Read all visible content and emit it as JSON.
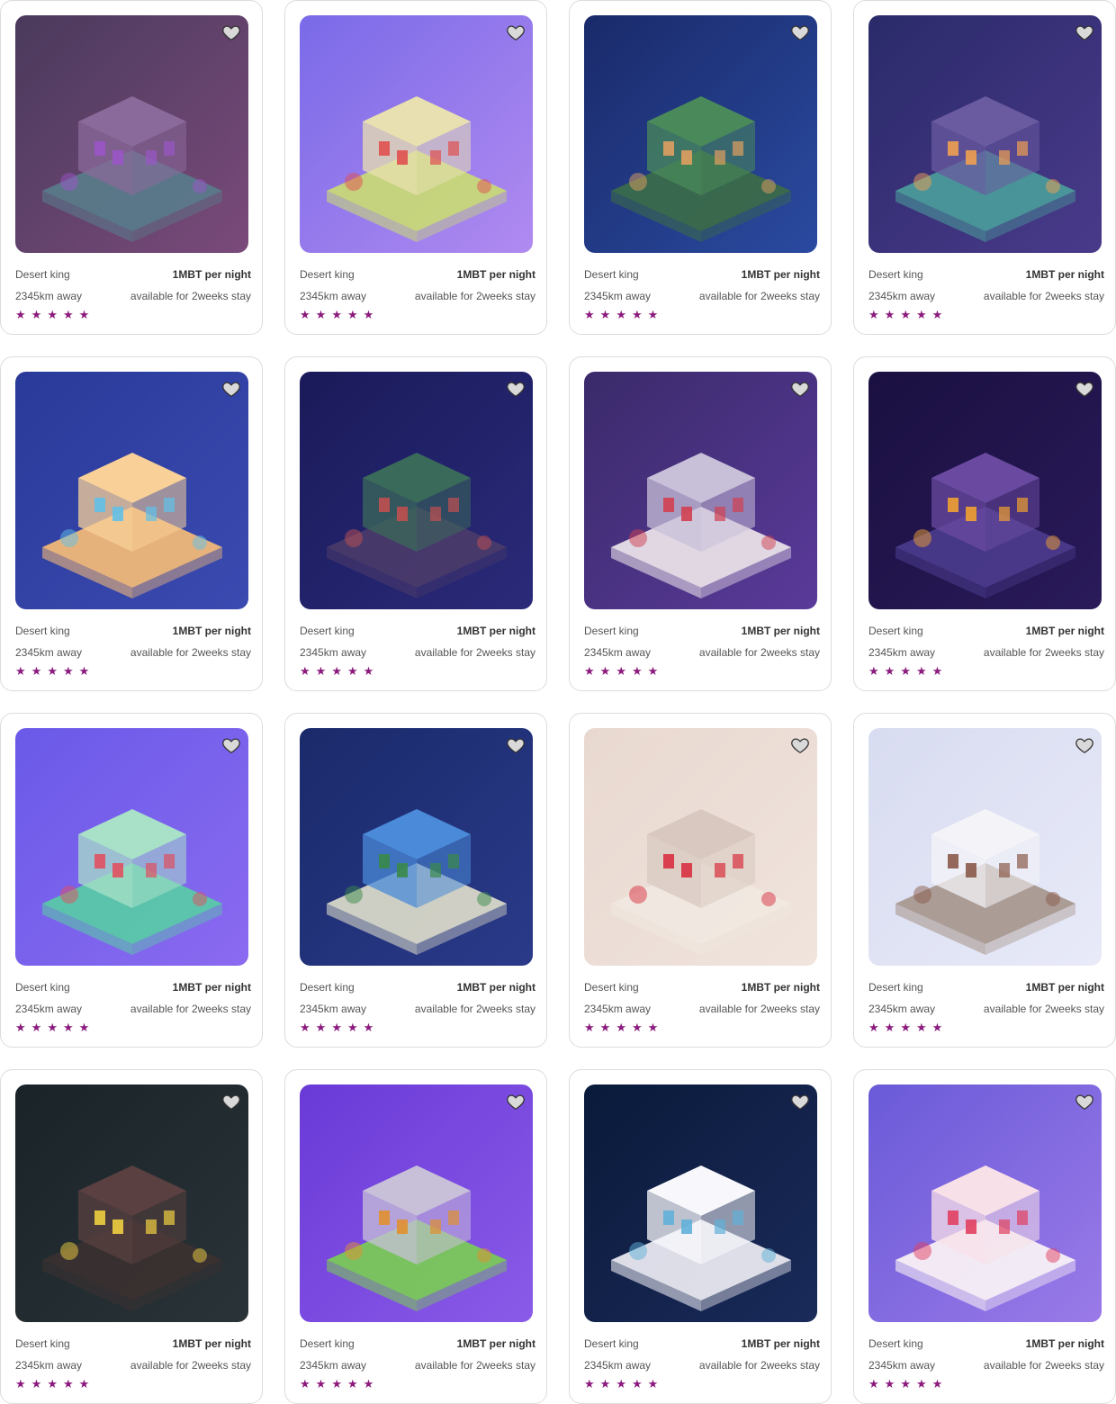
{
  "listings": [
    {
      "name": "Desert king",
      "price": "1MBT per night",
      "distance": "2345km away",
      "availability": "available for 2weeks stay",
      "rating": 5,
      "theme": "violet-tower"
    },
    {
      "name": "Desert king",
      "price": "1MBT per night",
      "distance": "2345km away",
      "availability": "available for 2weeks stay",
      "rating": 5,
      "theme": "fantasy-city"
    },
    {
      "name": "Desert king",
      "price": "1MBT per night",
      "distance": "2345km away",
      "availability": "available for 2weeks stay",
      "rating": 5,
      "theme": "floating-island"
    },
    {
      "name": "Desert king",
      "price": "1MBT per night",
      "distance": "2345km away",
      "availability": "available for 2weeks stay",
      "rating": 5,
      "theme": "night-castle"
    },
    {
      "name": "Desert king",
      "price": "1MBT per night",
      "distance": "2345km away",
      "availability": "available for 2weeks stay",
      "rating": 5,
      "theme": "desert-house"
    },
    {
      "name": "Desert king",
      "price": "1MBT per night",
      "distance": "2345km away",
      "availability": "available for 2weeks stay",
      "rating": 5,
      "theme": "forest-tower"
    },
    {
      "name": "Desert king",
      "price": "1MBT per night",
      "distance": "2345km away",
      "availability": "available for 2weeks stay",
      "rating": 5,
      "theme": "space-lab"
    },
    {
      "name": "Desert king",
      "price": "1MBT per night",
      "distance": "2345km away",
      "availability": "available for 2weeks stay",
      "rating": 5,
      "theme": "neon-temple"
    },
    {
      "name": "Desert king",
      "price": "1MBT per night",
      "distance": "2345km away",
      "availability": "available for 2weeks stay",
      "rating": 5,
      "theme": "market-stall"
    },
    {
      "name": "Desert king",
      "price": "1MBT per night",
      "distance": "2345km away",
      "availability": "available for 2weeks stay",
      "rating": 5,
      "theme": "stone-fort"
    },
    {
      "name": "Desert king",
      "price": "1MBT per night",
      "distance": "2345km away",
      "availability": "available for 2weeks stay",
      "rating": 5,
      "theme": "toy-workshop"
    },
    {
      "name": "Desert king",
      "price": "1MBT per night",
      "distance": "2345km away",
      "availability": "available for 2weeks stay",
      "rating": 5,
      "theme": "snow-cottage"
    },
    {
      "name": "Desert king",
      "price": "1MBT per night",
      "distance": "2345km away",
      "availability": "available for 2weeks stay",
      "rating": 5,
      "theme": "neon-diner"
    },
    {
      "name": "Desert king",
      "price": "1MBT per night",
      "distance": "2345km away",
      "availability": "available for 2weeks stay",
      "rating": 5,
      "theme": "autumn-bridge"
    },
    {
      "name": "Desert king",
      "price": "1MBT per night",
      "distance": "2345km away",
      "availability": "available for 2weeks stay",
      "rating": 5,
      "theme": "modern-villa"
    },
    {
      "name": "Desert king",
      "price": "1MBT per night",
      "distance": "2345km away",
      "availability": "available for 2weeks stay",
      "rating": 5,
      "theme": "candy-house"
    }
  ],
  "icons": {
    "favorite": "heart-outline-icon",
    "rating": "star-icon"
  },
  "colors": {
    "star": "#8b1a7d",
    "heart_fill": "#d9d9d9",
    "border": "#dcdcdc"
  }
}
